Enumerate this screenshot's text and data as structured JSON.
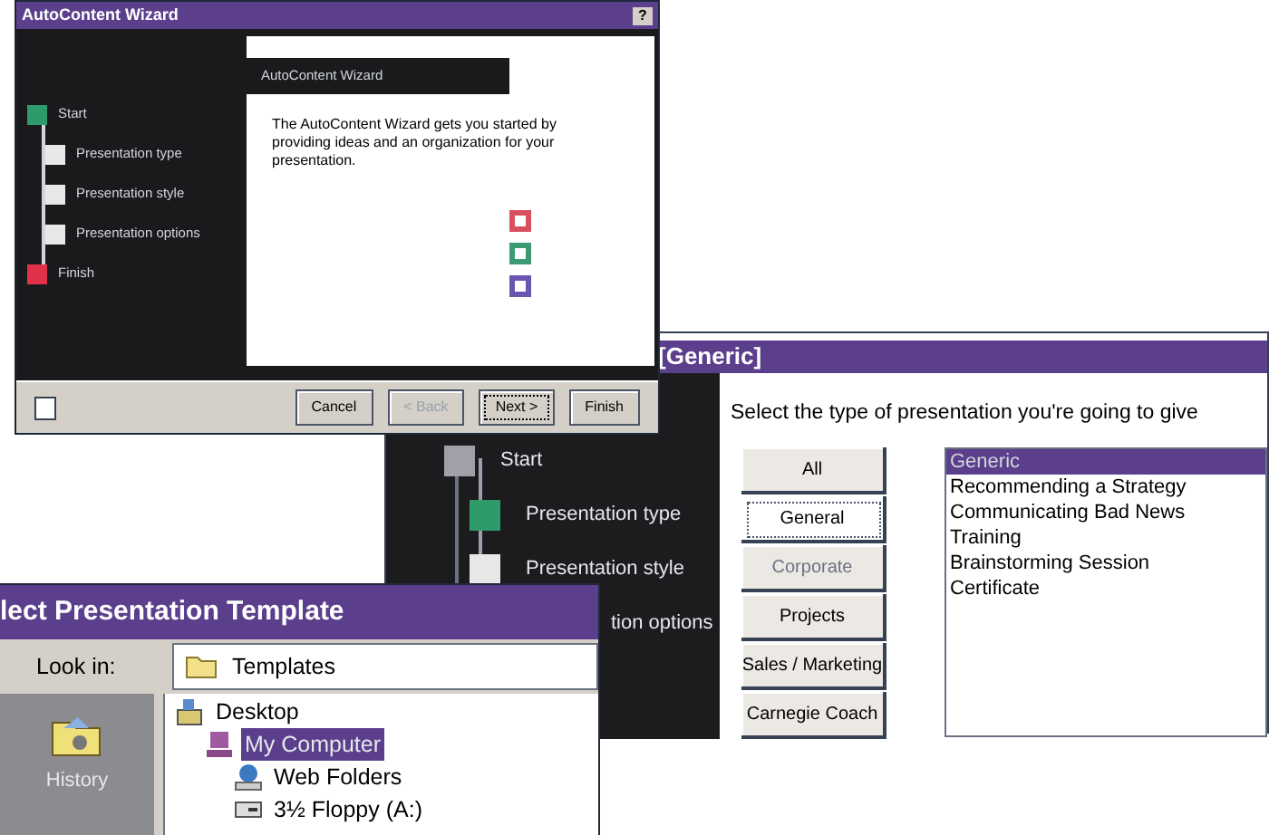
{
  "wizard": {
    "title": "AutoContent Wizard",
    "help_button": "?",
    "steps": [
      {
        "label": "Start",
        "color": "#2f9a6a",
        "indent": false
      },
      {
        "label": "Presentation type",
        "color": "#e8e8e8",
        "indent": true
      },
      {
        "label": "Presentation style",
        "color": "#e8e8e8",
        "indent": true
      },
      {
        "label": "Presentation options",
        "color": "#e8e8e8",
        "indent": true
      },
      {
        "label": "Finish",
        "color": "#e0304a",
        "indent": false
      }
    ],
    "panel_title": "AutoContent Wizard",
    "intro": "The AutoContent Wizard gets you started by providing ideas and an organization for your presentation.",
    "decor_squares": [
      {
        "color": "#d8505e"
      },
      {
        "color": "#3a9a72"
      },
      {
        "color": "#6a56b0"
      }
    ],
    "buttons": [
      {
        "label": "Cancel",
        "disabled": false,
        "selected": false
      },
      {
        "label": "< Back",
        "disabled": true,
        "selected": false
      },
      {
        "label": "Next >",
        "disabled": false,
        "selected": true
      },
      {
        "label": "Finish",
        "disabled": false,
        "selected": false
      }
    ]
  },
  "type_step": {
    "title": "[Generic]",
    "steps": [
      {
        "label": "Start",
        "color": "#a0a0a8",
        "kind": "branch"
      },
      {
        "label": "Presentation type",
        "color": "#2f9a6a",
        "kind": "leaf"
      },
      {
        "label": "Presentation style",
        "color": "#e8e8e8",
        "kind": "leaf"
      },
      {
        "label": "tion options",
        "kind": "partial"
      }
    ],
    "prompt": "Select the type of presentation you're going to give",
    "categories": [
      {
        "label": "All",
        "selected": false,
        "disabled": false
      },
      {
        "label": "General",
        "selected": true,
        "disabled": false
      },
      {
        "label": "Corporate",
        "selected": false,
        "disabled": true
      },
      {
        "label": "Projects",
        "selected": false,
        "disabled": false
      },
      {
        "label": "Sales / Marketing",
        "selected": false,
        "disabled": false
      },
      {
        "label": "Carnegie Coach",
        "selected": false,
        "disabled": false
      }
    ],
    "presentations": [
      {
        "label": "Generic",
        "selected": true
      },
      {
        "label": "Recommending a Strategy",
        "selected": false
      },
      {
        "label": "Communicating Bad News",
        "selected": false
      },
      {
        "label": "Training",
        "selected": false
      },
      {
        "label": "Brainstorming Session",
        "selected": false
      },
      {
        "label": "Certificate",
        "selected": false
      }
    ]
  },
  "template_dialog": {
    "title": "lect Presentation Template",
    "look_in_label": "Look in:",
    "look_in_value": "Templates",
    "places": [
      {
        "label": "History"
      }
    ],
    "folders": [
      {
        "label": "Desktop",
        "selected": false,
        "kind": "desktop",
        "children": [
          {
            "label": "My Computer",
            "selected": true,
            "kind": "computer",
            "children": [
              {
                "label": "Web Folders",
                "selected": false,
                "kind": "web"
              },
              {
                "label": "3½ Floppy (A:)",
                "selected": false,
                "kind": "floppy"
              }
            ]
          }
        ]
      }
    ]
  }
}
